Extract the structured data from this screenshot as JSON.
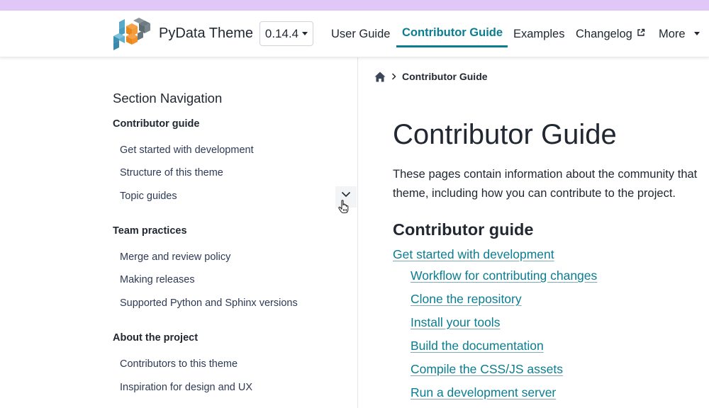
{
  "colors": {
    "top_strip": "#e0c7f7",
    "accent": "#0a7d91",
    "text": "#222832",
    "sidebar_link": "#2e3a55"
  },
  "header": {
    "brand": "PyData Theme",
    "version": "0.14.4",
    "nav": [
      {
        "label": "User Guide",
        "active": false
      },
      {
        "label": "Contributor Guide",
        "active": true
      },
      {
        "label": "Examples",
        "active": false
      },
      {
        "label": "Changelog",
        "active": false,
        "icon": "external-link-icon"
      },
      {
        "label": "More",
        "active": false,
        "icon": "caret-down-icon"
      }
    ]
  },
  "sidebar": {
    "title": "Section Navigation",
    "sections": [
      {
        "caption": "Contributor guide",
        "items": [
          {
            "label": "Get started with development"
          },
          {
            "label": "Structure of this theme"
          },
          {
            "label": "Topic guides",
            "expandable": true
          }
        ]
      },
      {
        "caption": "Team practices",
        "items": [
          {
            "label": "Merge and review policy"
          },
          {
            "label": "Making releases"
          },
          {
            "label": "Supported Python and Sphinx versions"
          }
        ]
      },
      {
        "caption": "About the project",
        "items": [
          {
            "label": "Contributors to this theme"
          },
          {
            "label": "Inspiration for design and UX"
          }
        ]
      }
    ]
  },
  "breadcrumb": {
    "home_icon": "home-icon",
    "current": "Contributor Guide"
  },
  "main": {
    "title": "Contributor Guide",
    "intro_line1": "These pages contain information about the community that",
    "intro_line2": "theme, including how you can contribute to the project.",
    "section_heading": "Contributor guide",
    "toc": [
      {
        "label": "Get started with development",
        "level": 1
      },
      {
        "label": "Workflow for contributing changes",
        "level": 2
      },
      {
        "label": "Clone the repository",
        "level": 2
      },
      {
        "label": "Install your tools",
        "level": 2
      },
      {
        "label": "Build the documentation",
        "level": 2
      },
      {
        "label": "Compile the CSS/JS assets",
        "level": 2
      },
      {
        "label": "Run a development server",
        "level": 2
      }
    ]
  }
}
